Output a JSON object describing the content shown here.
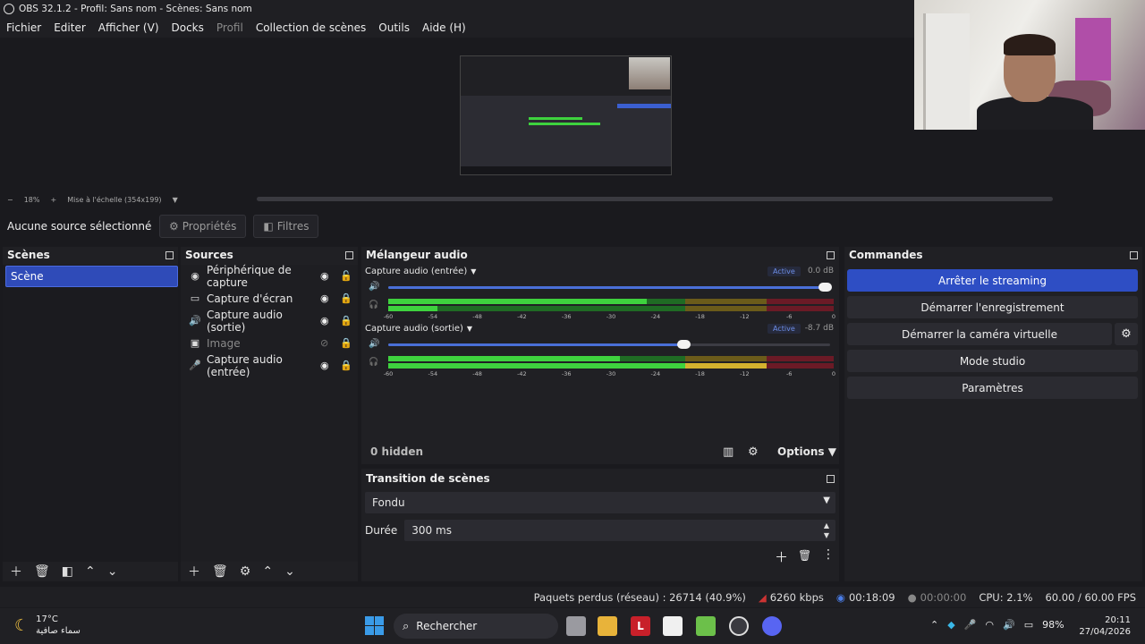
{
  "window": {
    "title": "OBS 32.1.2 - Profil: Sans nom - Scènes: Sans nom"
  },
  "menu": [
    "Fichier",
    "Editer",
    "Afficher (V)",
    "Docks",
    "Profil",
    "Collection de scènes",
    "Outils",
    "Aide (H)"
  ],
  "zoom": {
    "minus": "−",
    "level": "18%",
    "plus": "+",
    "scale_label": "Mise à l'échelle (354x199)"
  },
  "source_bar": {
    "no_selection": "Aucune source sélectionné",
    "properties": "Propriétés",
    "filters": "Filtres"
  },
  "scenes": {
    "title": "Scènes",
    "items": [
      "Scène"
    ]
  },
  "sources": {
    "title": "Sources",
    "items": [
      {
        "label": "Périphérique de capture",
        "icon": "camera-icon",
        "visible": true,
        "locked": false
      },
      {
        "label": "Capture d'écran",
        "icon": "monitor-icon",
        "visible": true,
        "locked": true
      },
      {
        "label": "Capture audio (sortie)",
        "icon": "speaker-icon",
        "visible": true,
        "locked": true
      },
      {
        "label": "Image",
        "icon": "image-icon",
        "visible": false,
        "locked": true
      },
      {
        "label": "Capture audio (entrée)",
        "icon": "microphone-icon",
        "visible": true,
        "locked": true
      }
    ]
  },
  "mixer": {
    "title": "Mélangeur audio",
    "channels": [
      {
        "name": "Capture audio (entrée)",
        "status": "Active",
        "db": "0.0 dB",
        "volume": 1.0,
        "level_top": 0.58,
        "level_bottom": 0.11
      },
      {
        "name": "Capture audio (sortie)",
        "status": "Active",
        "db": "-8.7 dB",
        "volume": 0.68,
        "level_top": 0.52,
        "level_bottom": 0.85
      }
    ],
    "scale": [
      "-60",
      "-54",
      "-48",
      "-42",
      "-36",
      "-30",
      "-24",
      "-18",
      "-12",
      "-6",
      "0"
    ],
    "hidden": "0 hidden",
    "options": "Options"
  },
  "transition": {
    "title": "Transition de scènes",
    "type": "Fondu",
    "duration_label": "Durée",
    "duration_value": "300 ms"
  },
  "commands": {
    "title": "Commandes",
    "stop_streaming": "Arrêter le streaming",
    "start_recording": "Démarrer l'enregistrement",
    "start_virtual_cam": "Démarrer la caméra virtuelle",
    "studio_mode": "Mode studio",
    "settings": "Paramètres"
  },
  "status": {
    "dropped": "Paquets perdus (réseau) : 26714 (40.9%)",
    "bitrate": "6260 kbps",
    "stream_time": "00:18:09",
    "rec_time": "00:00:00",
    "cpu": "CPU: 2.1%",
    "fps": "60.00 / 60.00 FPS"
  },
  "taskbar": {
    "temp": "17°C",
    "weather_text": "سماء صافية",
    "search": "Rechercher",
    "battery": "98%",
    "time": "20:11",
    "date": "27/04/2026"
  },
  "colors": {
    "accent": "#2e4ec4",
    "meter_green": "#3ed23e",
    "meter_yellow": "#d4b22e",
    "meter_red": "#6b1a26"
  }
}
